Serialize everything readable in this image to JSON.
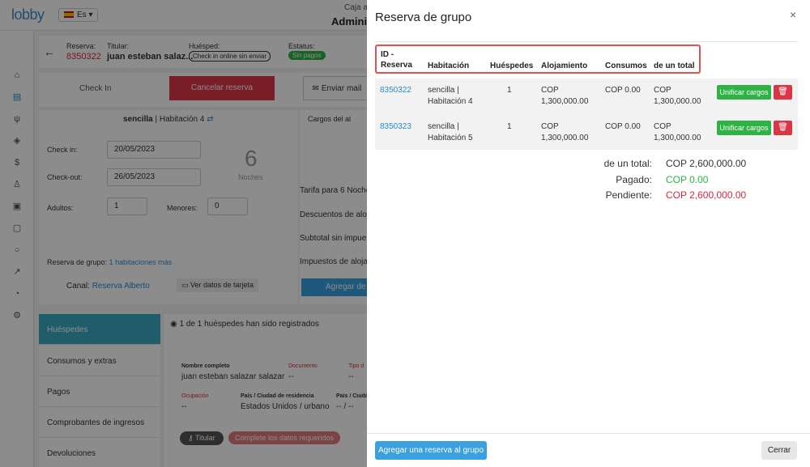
{
  "app": {
    "logo": "lobby",
    "lang": "Es",
    "hotel_label": "Caja a",
    "hotel_user": "Adminis"
  },
  "booking": {
    "reserva_label": "Reserva:",
    "reserva_id": "8350322",
    "titular_label": "Titular:",
    "titular_name": "juan esteban salaz...",
    "huesped_label": "Huésped:",
    "checkin_online": "Check in online sin enviar",
    "estatus_label": "Estatus:",
    "estatus_value": "Sin pagos",
    "checkin_btn": "Check In",
    "cancel_btn": "Cancelar reserva",
    "email_btn": "Enviar mail",
    "room": "sencilla",
    "room_num": "Habitación 4",
    "cargos_label": "Cargos del al",
    "checkin_label": "Check in:",
    "checkin_date": "20/05/2023",
    "checkout_label": "Check-out:",
    "checkout_date": "26/05/2023",
    "nights": "6",
    "nights_label": "Noches",
    "adultos_label": "Adultos:",
    "adultos": "1",
    "menores_label": "Menores:",
    "menores": "0",
    "tarifa": "Tarifa para 6 Noche",
    "descuentos": "Descuentos de aloj",
    "subtotal": "Subtotal sin impue",
    "impuestos": "Impuestos de aloja",
    "grupo_label": "Reserva de grupo:",
    "grupo_link": "1 habitaciones más",
    "canal_label": "Canal:",
    "canal_value": "Reserva Alberto",
    "tarjeta_btn": "Ver datos de tarjeta",
    "agregar_btn": "Agregar de"
  },
  "tabs": [
    "Huéspedes",
    "Consumos y extras",
    "Pagos",
    "Comprobantes de ingresos",
    "Devoluciones"
  ],
  "guests": {
    "registered": "1 de 1 huéspedes han sido registrados",
    "nombre_label": "Nombre completo",
    "nombre": "juan esteban salazar salazar",
    "documento_label": "Documento",
    "documento": "--",
    "tipo_label": "Tipo d",
    "tipo": "--",
    "ocupacion_label": "Ocupación",
    "ocupacion": "--",
    "pais_label": "País / Ciudad de residencia",
    "pais": "Estados Unidos / urbano",
    "pais2_label": "País / Ciudad",
    "pais2": "-- / --",
    "titular_badge": "Titular",
    "complete_badge": "Complete los datos requeridos"
  },
  "modal": {
    "title": "Reserva de grupo",
    "close": "×",
    "headers": {
      "id": "ID -",
      "id2": "Reserva",
      "habitacion": "Habitación",
      "huespedes": "Huéspedes",
      "alojamiento": "Alojamiento",
      "consumos": "Consumos",
      "total": "de un total"
    },
    "rows": [
      {
        "id": "8350322",
        "hab1": "sencilla |",
        "hab2": "Habitación 4",
        "huespedes": "1",
        "aloj1": "COP",
        "aloj2": "1,300,000.00",
        "consumos": "COP 0.00",
        "tot1": "COP",
        "tot2": "1,300,000.00",
        "unify": "Unificar cargos"
      },
      {
        "id": "8350323",
        "hab1": "sencilla |",
        "hab2": "Habitación 5",
        "huespedes": "1",
        "aloj1": "COP",
        "aloj2": "1,300,000.00",
        "consumos": "COP 0.00",
        "tot1": "COP",
        "tot2": "1,300,000.00",
        "unify": "Unificar cargos"
      }
    ],
    "totals": {
      "total_label": "de un total:",
      "total_value": "COP 2,600,000.00",
      "paid_label": "Pagado:",
      "paid_value": "COP 0.00",
      "pending_label": "Pendiente:",
      "pending_value": "COP 2,600,000.00"
    },
    "add_btn": "Agregar una reserva al grupo",
    "close_btn": "Cerrar"
  },
  "colors": {
    "green": "#2fb344",
    "red": "#dc3545",
    "blue": "#2a8bd0",
    "pending": "#d9283b"
  }
}
